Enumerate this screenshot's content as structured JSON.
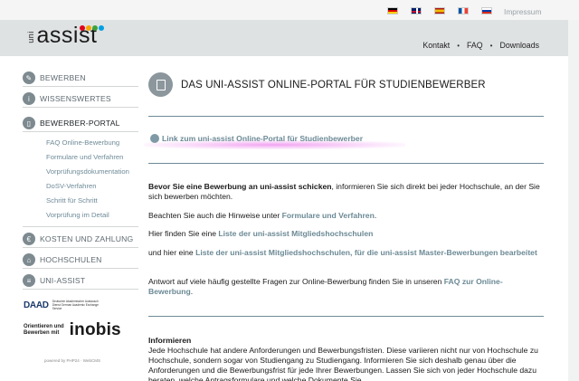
{
  "topbar": {
    "flags": [
      "de",
      "gb",
      "es",
      "fr",
      "ru"
    ],
    "impressum": "Impressum"
  },
  "header": {
    "logo_prefix": "uni",
    "logo_main": "assist",
    "logo_dot_colors": [
      "#e2001a",
      "#f7a600",
      "#3ea23a",
      "#009fe3"
    ],
    "nav": [
      "Kontakt",
      "FAQ",
      "Downloads"
    ],
    "nav_separator": "•"
  },
  "sidebar": {
    "items": [
      {
        "label": "BEWERBEN"
      },
      {
        "label": "WISSENSWERTES"
      },
      {
        "label": "BEWERBER-PORTAL"
      },
      {
        "label": "KOSTEN UND ZAHLUNG"
      },
      {
        "label": "HOCHSCHULEN"
      },
      {
        "label": "UNI-ASSIST"
      }
    ],
    "subitems": [
      "FAQ Online-Bewerbung",
      "Formulare und Verfahren",
      "Vorprüfungsdokumentation",
      "DoSV-Verfahren",
      "Schritt für Schritt",
      "Vorprüfung im Detail"
    ]
  },
  "partners": {
    "daad_mark": "DAAD",
    "daad_text": "Deutscher Akademischer Austausch Dienst German Academic Exchange Service",
    "inobis_small_1": "Orientieren und",
    "inobis_small_2": "Bewerben mit",
    "inobis_big": "inobis",
    "powered": "powered by PHP24 · WebCMS"
  },
  "main": {
    "title": "DAS UNI-ASSIST ONLINE-PORTAL FÜR STUDIENBEWERBER",
    "portal_link": "Link zum uni-assist Online-Portal für Studienbewerber",
    "p1_bold": "Bevor Sie eine Bewerbung an uni-assist schicken",
    "p1_rest": ", informieren Sie sich direkt bei jeder Hochschule, an der Sie sich bewerben möchten.",
    "p2_text": "Beachten Sie auch die Hinweise unter ",
    "p2_link": "Formulare und Verfahren",
    "p2_end": ".",
    "p3_text": "Hier finden Sie eine ",
    "p3_link": "Liste der uni-assist Mitgliedshochschulen",
    "p4_text": "und hier eine ",
    "p4_link": "Liste der uni-assist Mitgliedshochschulen, für die uni-assist Master-Bewerbungen bearbeitet",
    "p5_text": "Antwort auf viele häufig gestellte Fragen zur Online-Bewerbung finden Sie in unseren ",
    "p5_link": "FAQ zur Online-Bewerbung",
    "p5_end": ".",
    "info_heading": "Informieren",
    "info_text": "Jede Hochschule hat andere Anforderungen und Bewerbungsfristen. Diese variieren nicht nur von Hochschule zu Hochschule, sondern sogar von Studiengang zu Studiengang. Informieren Sie sich deshalb genau über die Anforderungen und die Bewerbungsfrist für jede Ihrer Bewerbungen. Lassen Sie sich von jeder Hochschule dazu beraten, welche Antragsformulare und welche Dokumente Sie"
  },
  "colors": {
    "link": "#6b8995",
    "highlight": "#e65ae6",
    "icon_gray": "#7d8a90"
  }
}
